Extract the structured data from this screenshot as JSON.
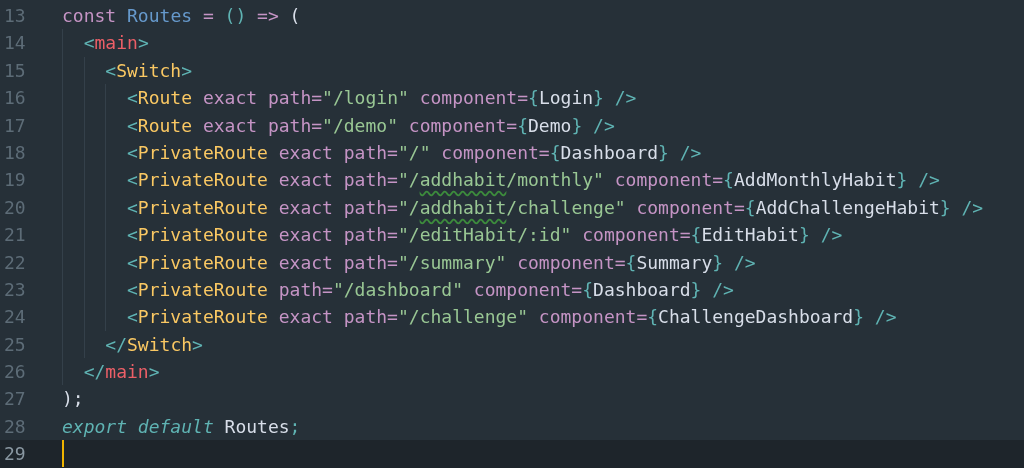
{
  "editor": {
    "lines": [
      {
        "number": "13",
        "current": false,
        "tokens": [
          {
            "kind": "keyword",
            "text": "const "
          },
          {
            "kind": "name",
            "text": "Routes "
          },
          {
            "kind": "operator",
            "text": "= "
          },
          {
            "kind": "punct",
            "text": "() "
          },
          {
            "kind": "operator",
            "text": "=> "
          },
          {
            "kind": "plain",
            "text": "("
          }
        ]
      },
      {
        "number": "14",
        "current": false,
        "tokens": [
          {
            "kind": "punct",
            "text": "  <"
          },
          {
            "kind": "html-tag",
            "text": "main"
          },
          {
            "kind": "punct",
            "text": ">"
          }
        ]
      },
      {
        "number": "15",
        "current": false,
        "tokens": [
          {
            "kind": "punct",
            "text": "    <"
          },
          {
            "kind": "tag",
            "text": "Switch"
          },
          {
            "kind": "punct",
            "text": ">"
          }
        ]
      },
      {
        "number": "16",
        "current": false,
        "tokens": [
          {
            "kind": "punct",
            "text": "      <"
          },
          {
            "kind": "tag",
            "text": "Route "
          },
          {
            "kind": "attr",
            "text": "exact path="
          },
          {
            "kind": "string",
            "text": "\"/login\" "
          },
          {
            "kind": "attr",
            "text": "component="
          },
          {
            "kind": "punct",
            "text": "{"
          },
          {
            "kind": "plain",
            "text": "Login"
          },
          {
            "kind": "punct",
            "text": "} />"
          }
        ]
      },
      {
        "number": "17",
        "current": false,
        "tokens": [
          {
            "kind": "punct",
            "text": "      <"
          },
          {
            "kind": "tag",
            "text": "Route "
          },
          {
            "kind": "attr",
            "text": "exact path="
          },
          {
            "kind": "string",
            "text": "\"/demo\" "
          },
          {
            "kind": "attr",
            "text": "component="
          },
          {
            "kind": "punct",
            "text": "{"
          },
          {
            "kind": "plain",
            "text": "Demo"
          },
          {
            "kind": "punct",
            "text": "} />"
          }
        ]
      },
      {
        "number": "18",
        "current": false,
        "tokens": [
          {
            "kind": "punct",
            "text": "      <"
          },
          {
            "kind": "tag",
            "text": "PrivateRoute "
          },
          {
            "kind": "attr",
            "text": "exact path="
          },
          {
            "kind": "string",
            "text": "\"/\" "
          },
          {
            "kind": "attr",
            "text": "component="
          },
          {
            "kind": "punct",
            "text": "{"
          },
          {
            "kind": "plain",
            "text": "Dashboard"
          },
          {
            "kind": "punct",
            "text": "} />"
          }
        ]
      },
      {
        "number": "19",
        "current": false,
        "tokens": [
          {
            "kind": "punct",
            "text": "      <"
          },
          {
            "kind": "tag",
            "text": "PrivateRoute "
          },
          {
            "kind": "attr",
            "text": "exact path="
          },
          {
            "kind": "string",
            "text": "\"/"
          },
          {
            "kind": "string",
            "text": "addhabit",
            "misspelled": true
          },
          {
            "kind": "string",
            "text": "/monthly\" "
          },
          {
            "kind": "attr",
            "text": "component="
          },
          {
            "kind": "punct",
            "text": "{"
          },
          {
            "kind": "plain",
            "text": "AddMonthlyHabit"
          },
          {
            "kind": "punct",
            "text": "} />"
          }
        ]
      },
      {
        "number": "20",
        "current": false,
        "tokens": [
          {
            "kind": "punct",
            "text": "      <"
          },
          {
            "kind": "tag",
            "text": "PrivateRoute "
          },
          {
            "kind": "attr",
            "text": "exact path="
          },
          {
            "kind": "string",
            "text": "\"/"
          },
          {
            "kind": "string",
            "text": "addhabit",
            "misspelled": true
          },
          {
            "kind": "string",
            "text": "/challenge\" "
          },
          {
            "kind": "attr",
            "text": "component="
          },
          {
            "kind": "punct",
            "text": "{"
          },
          {
            "kind": "plain",
            "text": "AddChallengeHabit"
          },
          {
            "kind": "punct",
            "text": "} />"
          }
        ]
      },
      {
        "number": "21",
        "current": false,
        "tokens": [
          {
            "kind": "punct",
            "text": "      <"
          },
          {
            "kind": "tag",
            "text": "PrivateRoute "
          },
          {
            "kind": "attr",
            "text": "exact path="
          },
          {
            "kind": "string",
            "text": "\"/editHabit/:id\" "
          },
          {
            "kind": "attr",
            "text": "component="
          },
          {
            "kind": "punct",
            "text": "{"
          },
          {
            "kind": "plain",
            "text": "EditHabit"
          },
          {
            "kind": "punct",
            "text": "} />"
          }
        ]
      },
      {
        "number": "22",
        "current": false,
        "tokens": [
          {
            "kind": "punct",
            "text": "      <"
          },
          {
            "kind": "tag",
            "text": "PrivateRoute "
          },
          {
            "kind": "attr",
            "text": "exact path="
          },
          {
            "kind": "string",
            "text": "\"/summary\" "
          },
          {
            "kind": "attr",
            "text": "component="
          },
          {
            "kind": "punct",
            "text": "{"
          },
          {
            "kind": "plain",
            "text": "Summary"
          },
          {
            "kind": "punct",
            "text": "} />"
          }
        ]
      },
      {
        "number": "23",
        "current": false,
        "tokens": [
          {
            "kind": "punct",
            "text": "      <"
          },
          {
            "kind": "tag",
            "text": "PrivateRoute "
          },
          {
            "kind": "attr",
            "text": "path="
          },
          {
            "kind": "string",
            "text": "\"/dashboard\" "
          },
          {
            "kind": "attr",
            "text": "component="
          },
          {
            "kind": "punct",
            "text": "{"
          },
          {
            "kind": "plain",
            "text": "Dashboard"
          },
          {
            "kind": "punct",
            "text": "} />"
          }
        ]
      },
      {
        "number": "24",
        "current": false,
        "tokens": [
          {
            "kind": "punct",
            "text": "      <"
          },
          {
            "kind": "tag",
            "text": "PrivateRoute "
          },
          {
            "kind": "attr",
            "text": "exact path="
          },
          {
            "kind": "string",
            "text": "\"/challenge\" "
          },
          {
            "kind": "attr",
            "text": "component="
          },
          {
            "kind": "punct",
            "text": "{"
          },
          {
            "kind": "plain",
            "text": "ChallengeDashboard"
          },
          {
            "kind": "punct",
            "text": "} />"
          }
        ]
      },
      {
        "number": "25",
        "current": false,
        "tokens": [
          {
            "kind": "punct",
            "text": "    </"
          },
          {
            "kind": "tag",
            "text": "Switch"
          },
          {
            "kind": "punct",
            "text": ">"
          }
        ]
      },
      {
        "number": "26",
        "current": false,
        "tokens": [
          {
            "kind": "punct",
            "text": "  </"
          },
          {
            "kind": "html-tag",
            "text": "main"
          },
          {
            "kind": "punct",
            "text": ">"
          }
        ]
      },
      {
        "number": "27",
        "current": false,
        "tokens": [
          {
            "kind": "plain",
            "text": ");"
          }
        ]
      },
      {
        "number": "28",
        "current": false,
        "tokens": [
          {
            "kind": "storage",
            "text": "export default "
          },
          {
            "kind": "plain",
            "text": "Routes"
          },
          {
            "kind": "punct",
            "text": ";"
          }
        ]
      },
      {
        "number": "29",
        "current": true
      }
    ]
  }
}
